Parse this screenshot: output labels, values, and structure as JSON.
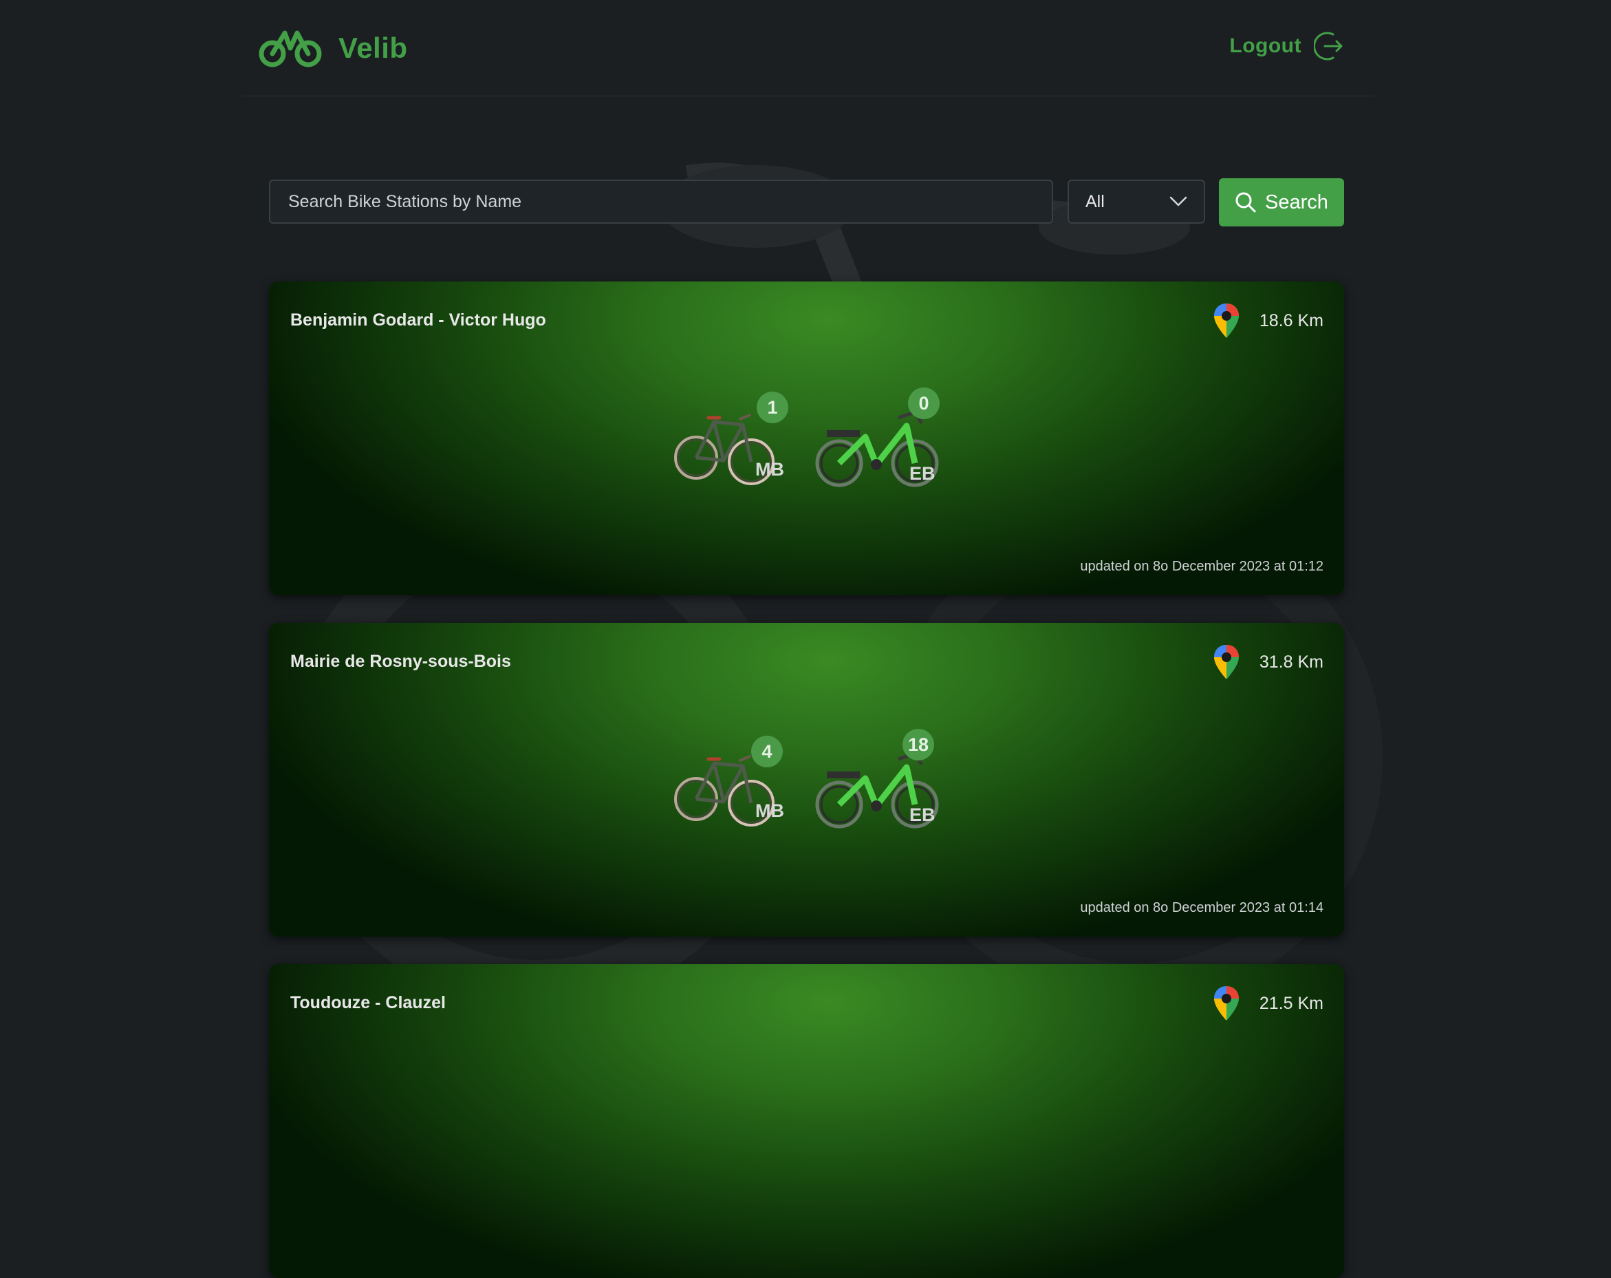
{
  "app": {
    "name": "Velib",
    "accent": "#43a047"
  },
  "header": {
    "logout_label": "Logout",
    "logout_icon": "logout-arrow-icon"
  },
  "search": {
    "placeholder": "Search Bike Stations by Name",
    "value": "",
    "filter_selected": "All",
    "button_label": "Search"
  },
  "stations": [
    {
      "name": "Benjamin Godard - Victor Hugo",
      "distance": "18.6 Km",
      "mechanical_count": "1",
      "electric_count": "0",
      "mechanical_label": "MB",
      "electric_label": "EB",
      "updated": "updated on 8o December 2023 at 01:12"
    },
    {
      "name": "Mairie de Rosny-sous-Bois",
      "distance": "31.8 Km",
      "mechanical_count": "4",
      "electric_count": "18",
      "mechanical_label": "MB",
      "electric_label": "EB",
      "updated": "updated on 8o December 2023 at 01:14"
    },
    {
      "name": "Toudouze - Clauzel",
      "distance": "21.5 Km"
    }
  ]
}
